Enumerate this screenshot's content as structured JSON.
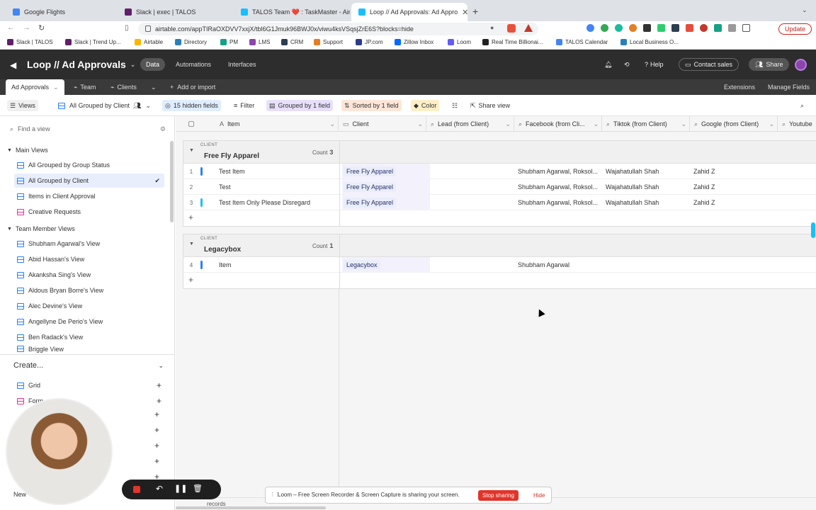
{
  "browser": {
    "tabs": [
      {
        "title": "Google Flights",
        "color": "#4285f4"
      },
      {
        "title": "Slack | exec | TALOS",
        "color": "#611f69"
      },
      {
        "title": "TALOS Team ❤️ : TaskMaster - Airta",
        "color": "#18bfff"
      },
      {
        "title": "Loop // Ad Approvals: Ad Appro",
        "color": "#18bfff"
      }
    ],
    "url": "airtable.com/appTIRaOXDVV7xxjX/tbl6G1Jmuk96BWJ0x/viwu4ksVSqsjZrE6S?blocks=hide",
    "update_label": "Update"
  },
  "bookmarks": [
    "Slack | TALOS",
    "Slack | Trend Up...",
    "Airtable",
    "Directory",
    "PM",
    "LMS",
    "CRM",
    "Support",
    "JP.com",
    "Zillow Inbox",
    "Loom",
    "Real Time Billionai...",
    "TALOS Calendar",
    "Local Business O..."
  ],
  "airtable": {
    "base_title": "Loop // Ad Approvals",
    "nav": {
      "data": "Data",
      "automations": "Automations",
      "interfaces": "Interfaces"
    },
    "help": "Help",
    "contact_sales": "Contact sales",
    "share": "Share",
    "tables": {
      "ad_approvals": "Ad Approvals",
      "team": "Team",
      "clients": "Clients",
      "add": "Add or import"
    },
    "extensions": "Extensions",
    "manage_fields": "Manage Fields"
  },
  "toolbar": {
    "views": "Views",
    "current_view": "All Grouped by Client",
    "hidden_fields": "15 hidden fields",
    "filter": "Filter",
    "grouped": "Grouped by 1 field",
    "sorted": "Sorted by 1 field",
    "color": "Color",
    "share_view": "Share view"
  },
  "sidebar": {
    "find_placeholder": "Find a view",
    "main_views": "Main Views",
    "main_items": [
      "All Grouped by Group Status",
      "All Grouped by Client",
      "Items in Client Approval",
      "Creative Requests"
    ],
    "team_views": "Team Member Views",
    "team_items": [
      "Shubham Agarwal's View",
      "Abid Hassan's View",
      "Akanksha Sing's View",
      "Aldous Bryan Borre's View",
      "Alec Devine's View",
      "Angellyne De Perio's View",
      "Ben Radack's View",
      "Briggle View"
    ],
    "create": "Create...",
    "create_items": [
      "Grid",
      "Form"
    ],
    "new_section": "New"
  },
  "grid": {
    "columns": [
      "Item",
      "Client",
      "Lead (from Client)",
      "Facebook (from Cli...",
      "Tiktok (from Client)",
      "Google (from Client)",
      "Youtube"
    ],
    "group_label": "CLIENT",
    "count_label": "Count",
    "groups": [
      {
        "name": "Free Fly Apparel",
        "count": "3",
        "rows": [
          {
            "num": "1",
            "item": "Test Item",
            "client": "Free Fly Apparel",
            "lead": "",
            "facebook": "Shubham Agarwal, Roksol...",
            "tiktok": "Wajahatullah Shah",
            "google": "Zahid Z",
            "bar": "#2d7ff9"
          },
          {
            "num": "2",
            "item": "Test",
            "client": "Free Fly Apparel",
            "lead": "",
            "facebook": "Shubham Agarwal, Roksol...",
            "tiktok": "Wajahatullah Shah",
            "google": "Zahid Z",
            "bar": "#ffffff"
          },
          {
            "num": "3",
            "item": "Test Item Only Please Disregard",
            "client": "Free Fly Apparel",
            "lead": "",
            "facebook": "Shubham Agarwal, Roksol...",
            "tiktok": "Wajahatullah Shah",
            "google": "Zahid Z",
            "bar": "#18bfff"
          }
        ]
      },
      {
        "name": "Legacybox",
        "count": "1",
        "rows": [
          {
            "num": "4",
            "item": "Item",
            "client": "Legacybox",
            "lead": "",
            "facebook": "Shubham Agarwal",
            "tiktok": "",
            "google": "",
            "bar": "#2d7ff9"
          }
        ]
      }
    ],
    "footer_records": "records"
  },
  "loom": {
    "message": "Loom – Free Screen Recorder & Screen Capture is sharing your screen.",
    "stop": "Stop sharing",
    "hide": "Hide"
  }
}
